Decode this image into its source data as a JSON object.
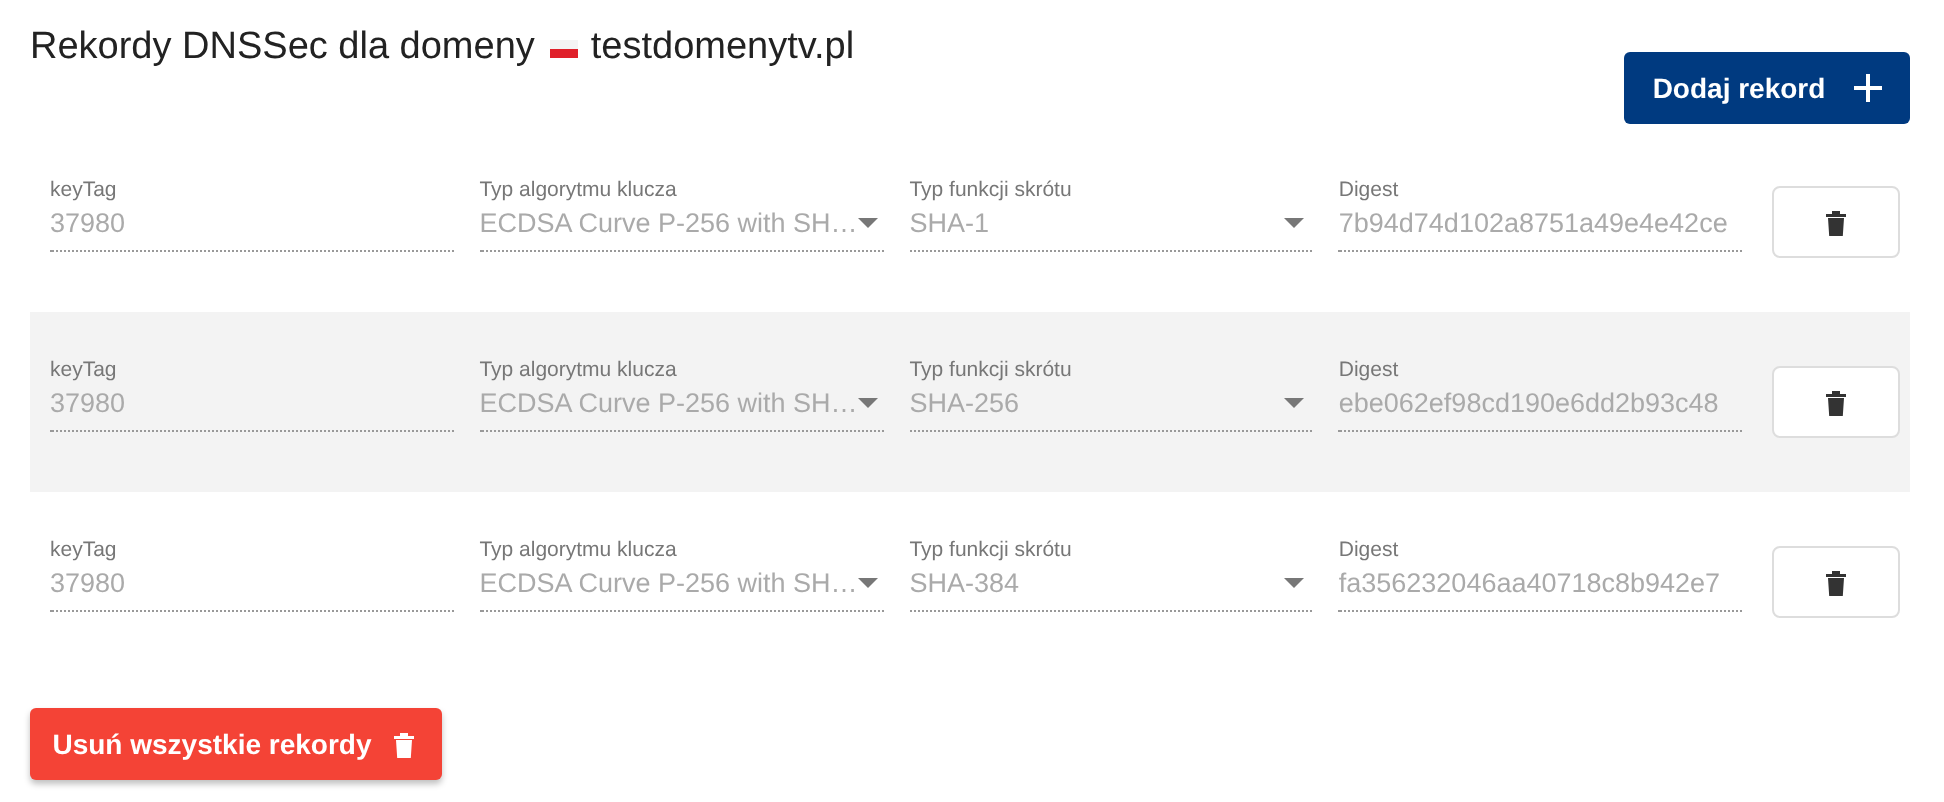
{
  "header": {
    "title": "Rekordy DNSSec dla domeny",
    "domain": "testdomenytv.pl"
  },
  "add_button": {
    "label": "Dodaj rekord"
  },
  "records": [
    {
      "disabled": true,
      "fields": [
        {
          "kind": "text",
          "label": "keyTag",
          "value": "37980"
        },
        {
          "kind": "select",
          "label": "Typ algorytmu klucza",
          "value": "ECDSA Curve P-256 with SH…"
        },
        {
          "kind": "select",
          "label": "Typ funkcji skrótu",
          "value": "SHA-1"
        },
        {
          "kind": "text",
          "label": "Digest",
          "value": "7b94d74d102a8751a49e4e42ce"
        }
      ]
    },
    {
      "disabled": true,
      "fields": [
        {
          "kind": "text",
          "label": "keyTag",
          "value": "37980"
        },
        {
          "kind": "select",
          "label": "Typ algorytmu klucza",
          "value": "ECDSA Curve P-256 with SH…"
        },
        {
          "kind": "select",
          "label": "Typ funkcji skrótu",
          "value": "SHA-256"
        },
        {
          "kind": "text",
          "label": "Digest",
          "value": "ebe062ef98cd190e6dd2b93c48"
        }
      ]
    },
    {
      "disabled": true,
      "fields": [
        {
          "kind": "text",
          "label": "keyTag",
          "value": "37980"
        },
        {
          "kind": "select",
          "label": "Typ algorytmu klucza",
          "value": "ECDSA Curve P-256 with SH…"
        },
        {
          "kind": "select",
          "label": "Typ funkcji skrótu",
          "value": "SHA-384"
        },
        {
          "kind": "text",
          "label": "Digest",
          "value": "fa356232046aa40718c8b942e7"
        }
      ]
    }
  ],
  "delete_all_button": {
    "label": "Usuń wszystkie rekordy"
  }
}
